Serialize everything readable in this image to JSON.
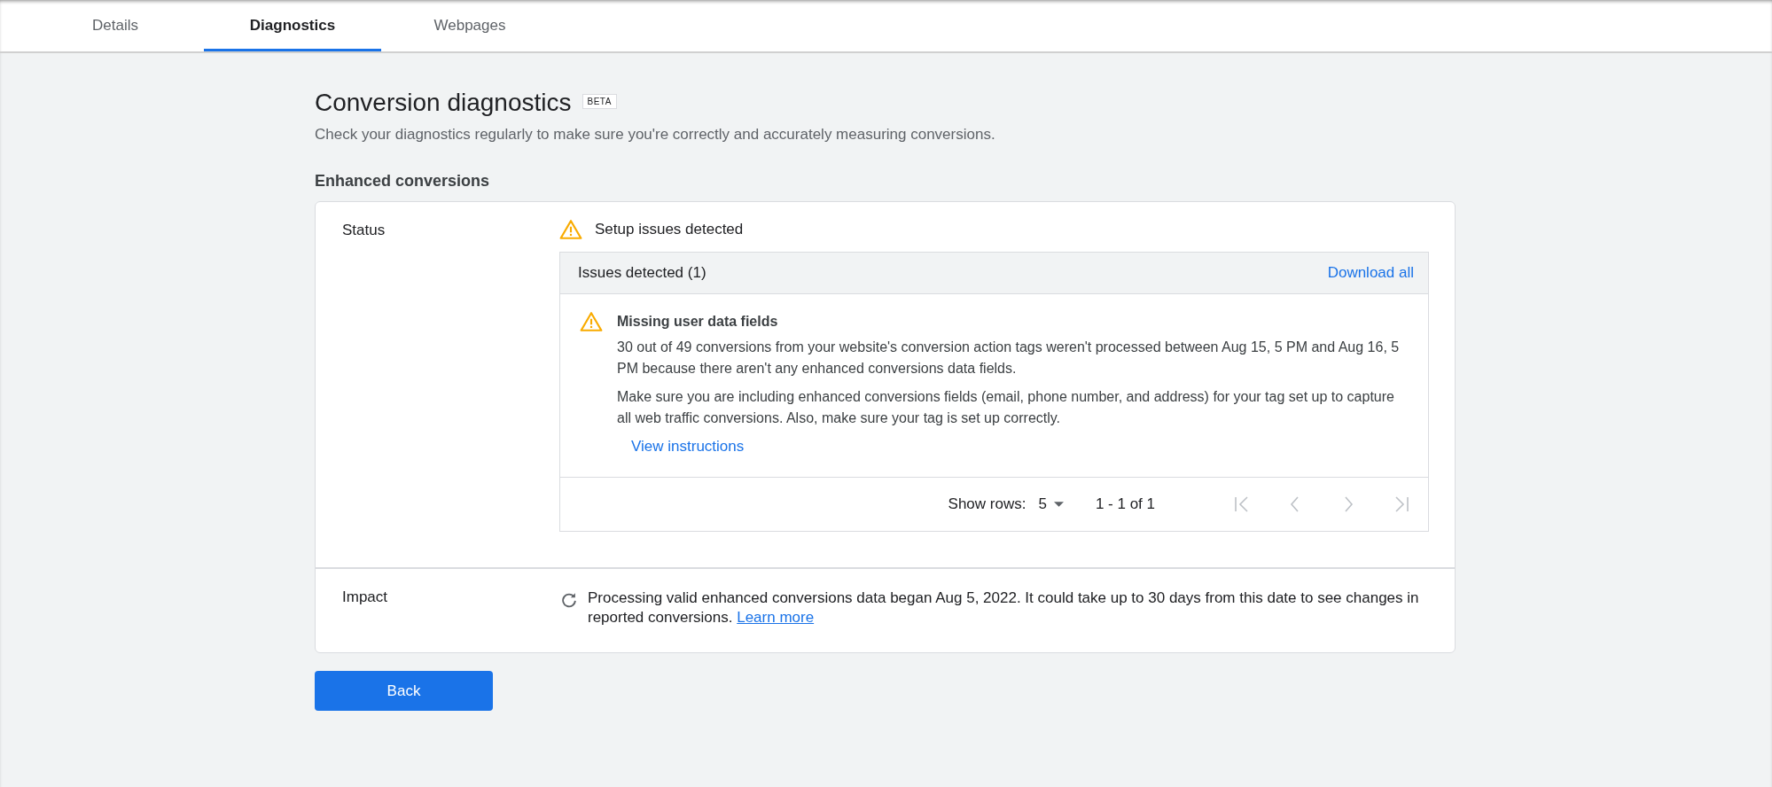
{
  "tabs": [
    {
      "label": "Details",
      "selected": false
    },
    {
      "label": "Diagnostics",
      "selected": true
    },
    {
      "label": "Webpages",
      "selected": false
    }
  ],
  "header": {
    "title": "Conversion diagnostics",
    "badge": "BETA",
    "description": "Check your diagnostics regularly to make sure you're correctly and accurately measuring conversions."
  },
  "section": {
    "title": "Enhanced conversions",
    "status": {
      "label": "Status",
      "value": "Setup issues detected",
      "issues_table": {
        "title": "Issues detected (1)",
        "action": "Download all",
        "issues": [
          {
            "title": "Missing user data fields",
            "paragraphs": [
              "30 out of 49 conversions from your website's conversion action tags weren't processed between Aug 15, 5 PM and Aug 16, 5 PM because there aren't any enhanced conversions data fields.",
              "Make sure you are including enhanced conversions fields (email, phone number, and address) for your tag set up to capture all web traffic conversions. Also, make sure your tag is set up correctly."
            ],
            "link": "View instructions"
          }
        ],
        "pagination": {
          "rows_label": "Show rows:",
          "rows_value": "5",
          "range": "1 - 1 of 1"
        }
      }
    },
    "impact": {
      "label": "Impact",
      "text": "Processing valid enhanced conversions data began Aug 5, 2022. It could take up to 30 days from this date to see changes in reported conversions.",
      "link": "Learn more"
    }
  },
  "buttons": [
    {
      "label": "Back"
    }
  ]
}
